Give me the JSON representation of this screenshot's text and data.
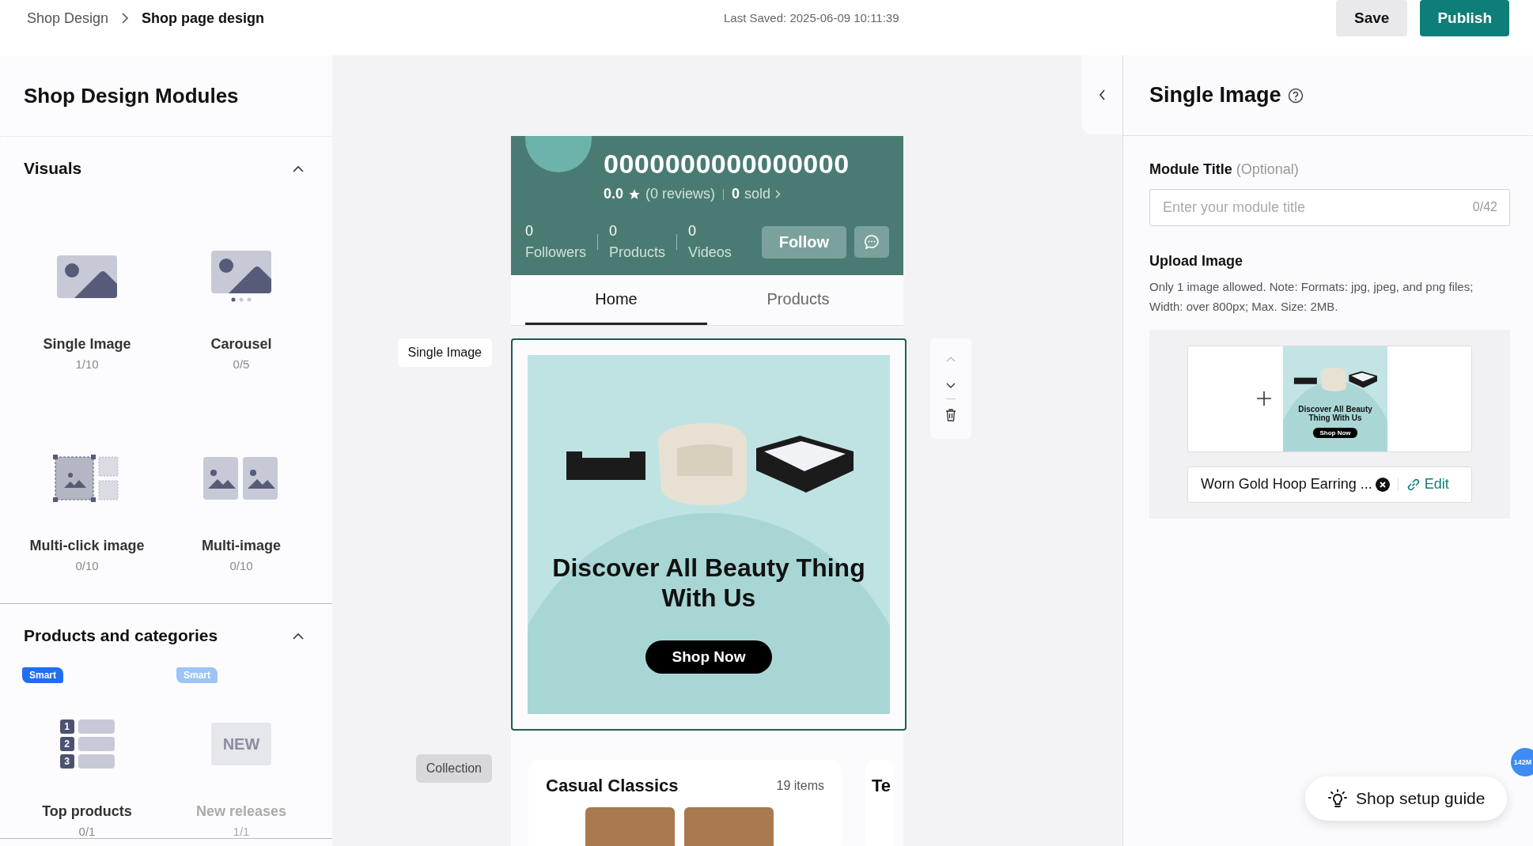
{
  "topbar": {
    "breadcrumb": [
      {
        "label": "Shop Design",
        "current": false
      },
      {
        "label": "Shop page design",
        "current": true
      }
    ],
    "last_saved": "Last Saved: 2025-06-09 10:11:39",
    "save": "Save",
    "publish": "Publish"
  },
  "modules_panel": {
    "title": "Shop Design Modules",
    "sections": [
      {
        "title": "Visuals",
        "expanded": true,
        "modules": [
          {
            "kind": "single",
            "name": "Single Image",
            "count": "1/10",
            "disabled": false
          },
          {
            "kind": "carousel",
            "name": "Carousel",
            "count": "0/5",
            "disabled": false
          },
          {
            "kind": "multiclick",
            "name": "Multi-click image",
            "count": "0/10",
            "disabled": false
          },
          {
            "kind": "multi",
            "name": "Multi-image",
            "count": "0/10",
            "disabled": false
          }
        ]
      },
      {
        "title": "Products and categories",
        "expanded": true,
        "modules": [
          {
            "kind": "top",
            "name": "Top products",
            "count": "0/1",
            "disabled": false,
            "badge": "Smart",
            "icon_numbers": [
              "1",
              "2",
              "3"
            ]
          },
          {
            "kind": "new",
            "name": "New releases",
            "count": "1/1",
            "disabled": true,
            "badge": "Smart",
            "icon_text": "NEW"
          }
        ]
      }
    ]
  },
  "preview": {
    "shop": {
      "name": "0000000000000000",
      "rating": "0.0",
      "reviews": "(0 reviews)",
      "sold_count": "0",
      "sold_label": "sold",
      "stats": [
        {
          "value": "0",
          "label": "Followers"
        },
        {
          "value": "0",
          "label": "Products"
        },
        {
          "value": "0",
          "label": "Videos"
        }
      ],
      "follow": "Follow"
    },
    "tabs": [
      {
        "label": "Home",
        "selected": true
      },
      {
        "label": "Products",
        "selected": false
      }
    ],
    "single_image": {
      "label": "Single Image",
      "selected": true,
      "headline": "Discover All Beauty Thing With Us",
      "button": "Shop Now"
    },
    "collection": {
      "label": "Collection",
      "cards": [
        {
          "title": "Casual Classics",
          "count": "19 items"
        },
        {
          "title": "Te"
        }
      ]
    }
  },
  "settings": {
    "title": "Single Image",
    "module_title": {
      "label": "Module Title",
      "optional": "(Optional)",
      "placeholder": "Enter your module title",
      "counter": "0/42"
    },
    "upload": {
      "label": "Upload Image",
      "note": "Only 1 image allowed. Note: Formats: jpg, jpeg, and png files; Width: over 800px; Max. Size: 2MB.",
      "thumbnail": {
        "headline": "Discover All Beauty Thing With Us",
        "button": "Shop Now"
      },
      "link_text": "Worn Gold Hoop Earring ...",
      "edit": "Edit"
    }
  },
  "guide_button": "Shop setup guide",
  "floating_badge": "142M"
}
